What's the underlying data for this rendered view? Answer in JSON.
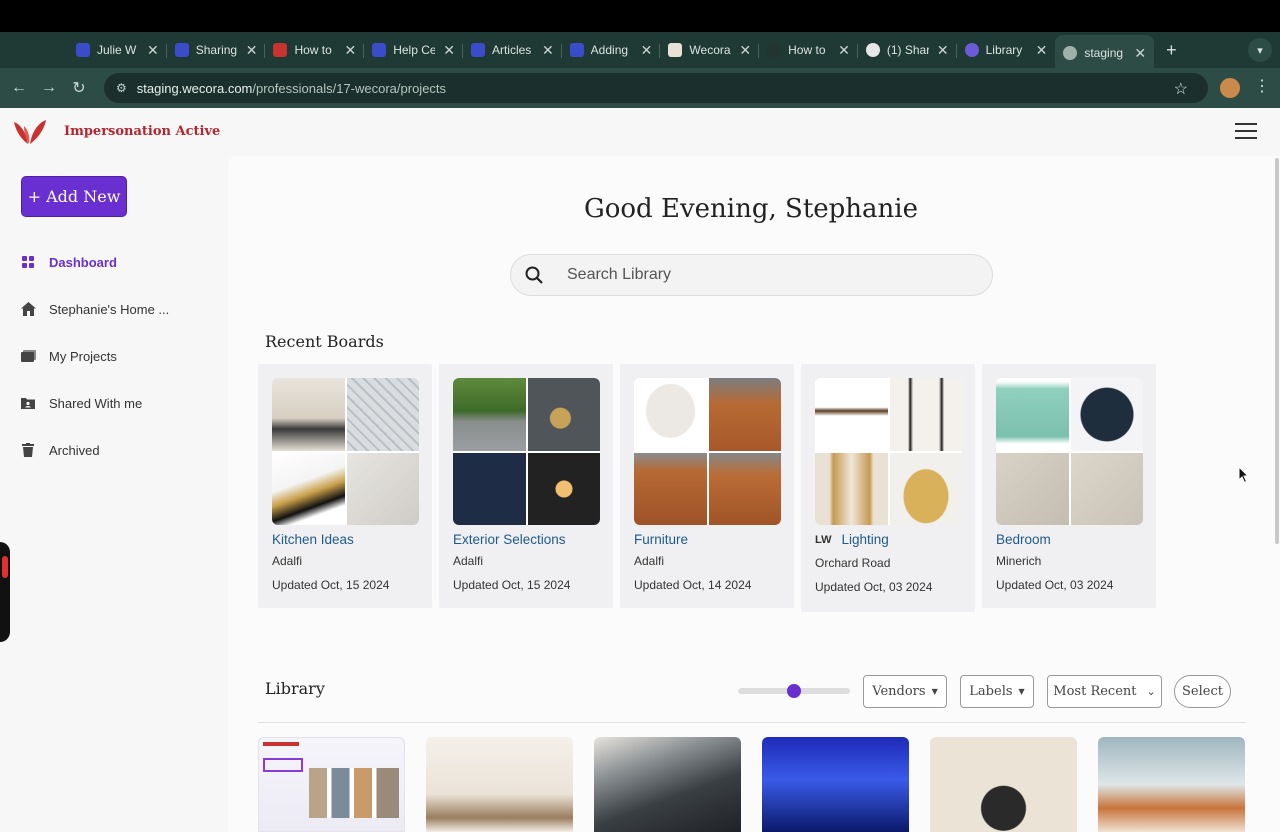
{
  "browser": {
    "tabs": [
      {
        "title": "Julie W",
        "icon": "intercom-icon"
      },
      {
        "title": "Sharing",
        "icon": "intercom-icon"
      },
      {
        "title": "How to",
        "icon": "wecora-icon"
      },
      {
        "title": "Help Ce",
        "icon": "intercom-icon"
      },
      {
        "title": "Articles",
        "icon": "intercom-icon"
      },
      {
        "title": "Adding",
        "icon": "intercom-icon"
      },
      {
        "title": "Wecora",
        "icon": "image-icon"
      },
      {
        "title": "How to",
        "icon": "dark-icon"
      },
      {
        "title": "(1) Shar",
        "icon": "github-icon"
      },
      {
        "title": "Library",
        "icon": "gear-icon"
      },
      {
        "title": "staging",
        "icon": "globe-icon"
      }
    ],
    "url_domain": "staging.wecora.com",
    "url_path": "/professionals/17-wecora/projects"
  },
  "header": {
    "impersonation": "Impersonation Active"
  },
  "sidebar": {
    "add_new": "+ Add New",
    "items": [
      {
        "label": "Dashboard"
      },
      {
        "label": "Stephanie's Home ..."
      },
      {
        "label": "My Projects"
      },
      {
        "label": "Shared With me"
      },
      {
        "label": "Archived"
      }
    ]
  },
  "main": {
    "greeting": "Good Evening, Stephanie",
    "search_placeholder": "Search Library",
    "recent_boards_title": "Recent Boards",
    "boards": [
      {
        "name": "Kitchen Ideas",
        "owner": "Adalfi",
        "updated": "Updated Oct, 15 2024"
      },
      {
        "name": "Exterior Selections",
        "owner": "Adalfi",
        "updated": "Updated Oct, 15 2024"
      },
      {
        "name": "Furniture",
        "owner": "Adalfi",
        "updated": "Updated Oct, 14 2024"
      },
      {
        "name": "Lighting",
        "badge": "LW",
        "owner": "Orchard Road",
        "updated": "Updated Oct, 03 2024"
      },
      {
        "name": "Bedroom",
        "owner": "Minerich",
        "updated": "Updated Oct, 03 2024"
      }
    ],
    "library_title": "Library",
    "filters": {
      "vendors": "Vendors",
      "labels": "Labels",
      "sort": "Most Recent",
      "select": "Select"
    },
    "zoom_slider_level": 0.5
  },
  "colors": {
    "accent": "#6a2fd1",
    "brand_red": "#b3262e",
    "link": "#1f5a8a"
  }
}
